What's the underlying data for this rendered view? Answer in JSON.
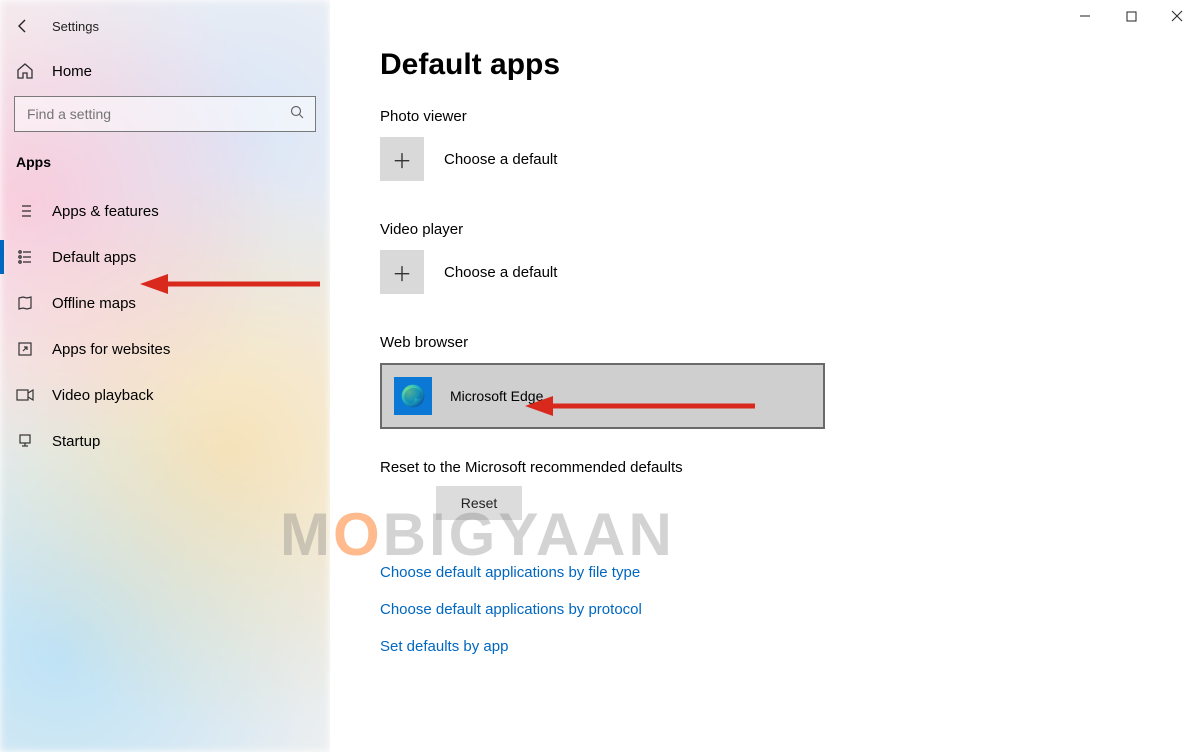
{
  "window": {
    "title": "Settings"
  },
  "sidebar": {
    "home": "Home",
    "search_placeholder": "Find a setting",
    "section": "Apps",
    "items": [
      {
        "label": "Apps & features",
        "active": false
      },
      {
        "label": "Default apps",
        "active": true
      },
      {
        "label": "Offline maps",
        "active": false
      },
      {
        "label": "Apps for websites",
        "active": false
      },
      {
        "label": "Video playback",
        "active": false
      },
      {
        "label": "Startup",
        "active": false
      }
    ]
  },
  "main": {
    "page_title": "Default apps",
    "blocks": {
      "photo": {
        "heading": "Photo viewer",
        "choose": "Choose a default"
      },
      "video": {
        "heading": "Video player",
        "choose": "Choose a default"
      },
      "browser": {
        "heading": "Web browser",
        "value": "Microsoft Edge"
      }
    },
    "reset": {
      "heading": "Reset to the Microsoft recommended defaults",
      "button": "Reset"
    },
    "links": [
      "Choose default applications by file type",
      "Choose default applications by protocol",
      "Set defaults by app"
    ]
  },
  "watermark": "MOBIGYAAN"
}
